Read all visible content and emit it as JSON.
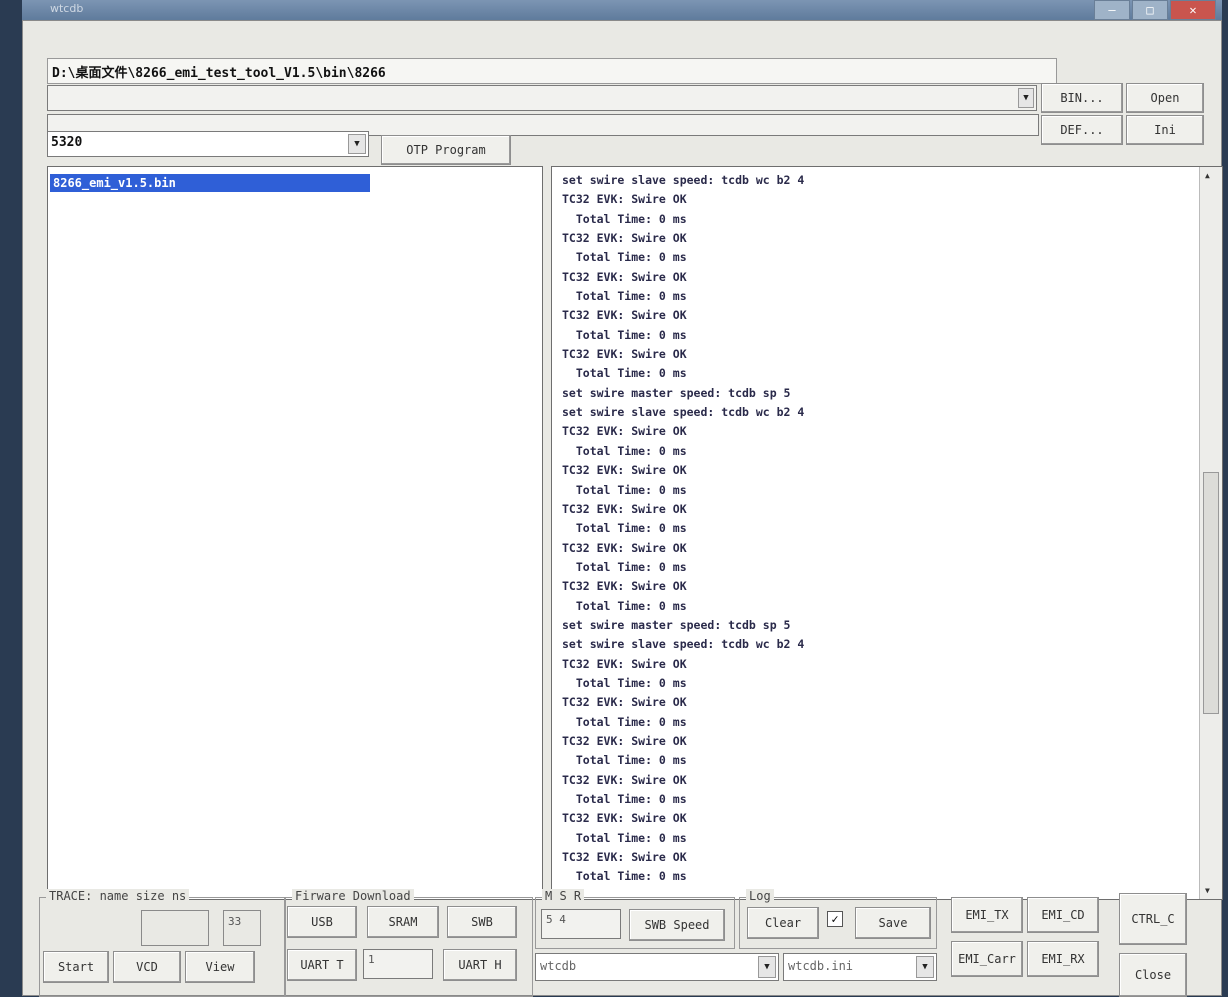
{
  "window": {
    "title": "wtcdb"
  },
  "path": {
    "value": "D:\\桌面文件\\8266_emi_test_tool_V1.5\\bin\\8266"
  },
  "secondary_path": {
    "value": ""
  },
  "buttons": {
    "bin": "BIN...",
    "open": "Open",
    "def": "DEF...",
    "ini": "Ini",
    "otp": "OTP Program",
    "emi_tx": "EMI_TX",
    "emi_cd": "EMI_CD",
    "ctrl_c": "CTRL_C",
    "emi_carr": "EMI_Carr",
    "emi_rx": "EMI_RX",
    "close": "Close"
  },
  "chip_select": {
    "value": "5320"
  },
  "file_list": {
    "items": [
      "8266_emi_v1.5.bin"
    ]
  },
  "log": {
    "lines": [
      "set swire slave speed: tcdb wc b2 4",
      "TC32 EVK: Swire OK",
      "  Total Time: 0 ms",
      "TC32 EVK: Swire OK",
      "  Total Time: 0 ms",
      "TC32 EVK: Swire OK",
      "  Total Time: 0 ms",
      "TC32 EVK: Swire OK",
      "  Total Time: 0 ms",
      "TC32 EVK: Swire OK",
      "  Total Time: 0 ms",
      "set swire master speed: tcdb sp 5",
      "set swire slave speed: tcdb wc b2 4",
      "TC32 EVK: Swire OK",
      "  Total Time: 0 ms",
      "TC32 EVK: Swire OK",
      "  Total Time: 0 ms",
      "TC32 EVK: Swire OK",
      "  Total Time: 0 ms",
      "TC32 EVK: Swire OK",
      "  Total Time: 0 ms",
      "TC32 EVK: Swire OK",
      "  Total Time: 0 ms",
      "set swire master speed: tcdb sp 5",
      "set swire slave speed: tcdb wc b2 4",
      "TC32 EVK: Swire OK",
      "  Total Time: 0 ms",
      "TC32 EVK: Swire OK",
      "  Total Time: 0 ms",
      "TC32 EVK: Swire OK",
      "  Total Time: 0 ms",
      "TC32 EVK: Swire OK",
      "  Total Time: 0 ms",
      "TC32 EVK: Swire OK",
      "  Total Time: 0 ms",
      "TC32 EVK: Swire OK",
      "  Total Time: 0 ms"
    ]
  },
  "trace": {
    "label": "TRACE: name size ns",
    "name_value": "",
    "size_value": "33",
    "start": "Start",
    "vcd": "VCD",
    "view": "View"
  },
  "firmware": {
    "label": "Firware Download",
    "usb": "USB",
    "sram": "SRAM",
    "swb": "SWB",
    "uart_t": "UART T",
    "uart_value": "1",
    "uart_h": "UART H"
  },
  "msr": {
    "label": "M  S  R",
    "value": "5 4",
    "swb_speed": "SWB Speed"
  },
  "logbox": {
    "label": "Log",
    "clear": "Clear",
    "checked": true,
    "save": "Save"
  },
  "bottom": {
    "cmd_value": "wtcdb",
    "ini_value": "wtcdb.ini"
  },
  "icons": {
    "check": "✓",
    "down": "▼",
    "up": "▲"
  }
}
